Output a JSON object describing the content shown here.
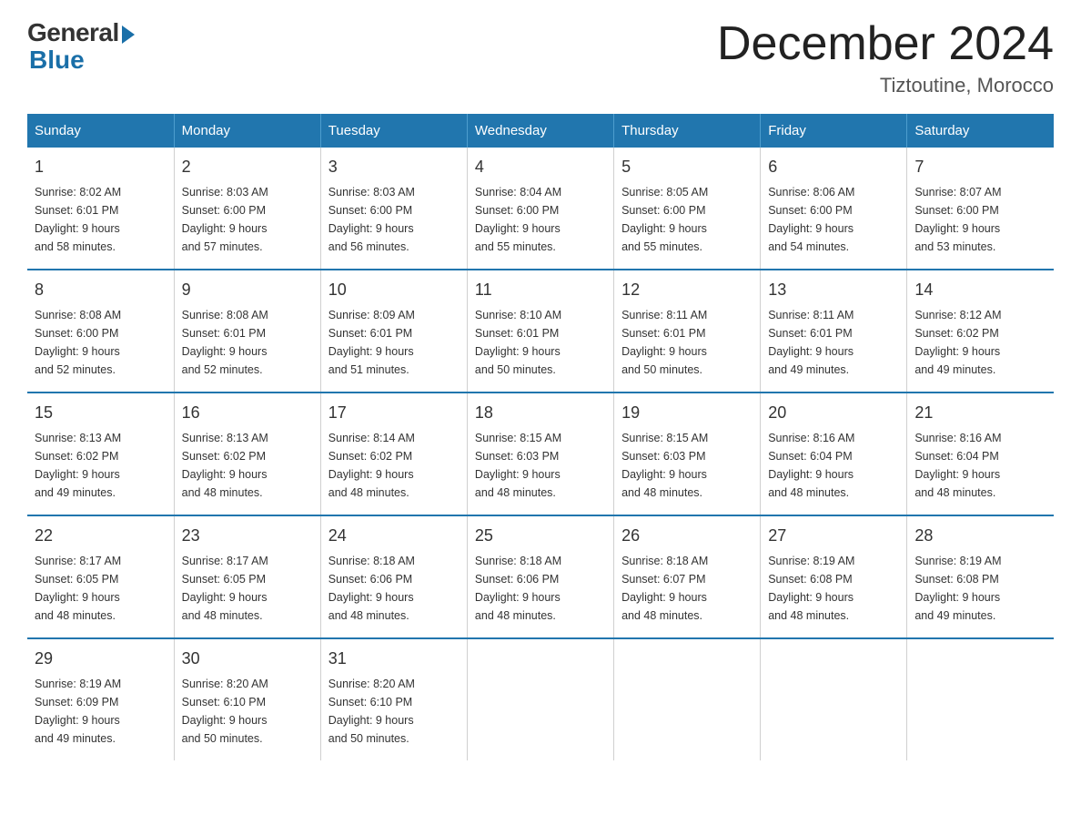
{
  "logo": {
    "general": "General",
    "blue": "Blue"
  },
  "title": "December 2024",
  "location": "Tiztoutine, Morocco",
  "days_header": [
    "Sunday",
    "Monday",
    "Tuesday",
    "Wednesday",
    "Thursday",
    "Friday",
    "Saturday"
  ],
  "weeks": [
    [
      {
        "day": "1",
        "sunrise": "8:02 AM",
        "sunset": "6:01 PM",
        "daylight": "9 hours and 58 minutes."
      },
      {
        "day": "2",
        "sunrise": "8:03 AM",
        "sunset": "6:00 PM",
        "daylight": "9 hours and 57 minutes."
      },
      {
        "day": "3",
        "sunrise": "8:03 AM",
        "sunset": "6:00 PM",
        "daylight": "9 hours and 56 minutes."
      },
      {
        "day": "4",
        "sunrise": "8:04 AM",
        "sunset": "6:00 PM",
        "daylight": "9 hours and 55 minutes."
      },
      {
        "day": "5",
        "sunrise": "8:05 AM",
        "sunset": "6:00 PM",
        "daylight": "9 hours and 55 minutes."
      },
      {
        "day": "6",
        "sunrise": "8:06 AM",
        "sunset": "6:00 PM",
        "daylight": "9 hours and 54 minutes."
      },
      {
        "day": "7",
        "sunrise": "8:07 AM",
        "sunset": "6:00 PM",
        "daylight": "9 hours and 53 minutes."
      }
    ],
    [
      {
        "day": "8",
        "sunrise": "8:08 AM",
        "sunset": "6:00 PM",
        "daylight": "9 hours and 52 minutes."
      },
      {
        "day": "9",
        "sunrise": "8:08 AM",
        "sunset": "6:01 PM",
        "daylight": "9 hours and 52 minutes."
      },
      {
        "day": "10",
        "sunrise": "8:09 AM",
        "sunset": "6:01 PM",
        "daylight": "9 hours and 51 minutes."
      },
      {
        "day": "11",
        "sunrise": "8:10 AM",
        "sunset": "6:01 PM",
        "daylight": "9 hours and 50 minutes."
      },
      {
        "day": "12",
        "sunrise": "8:11 AM",
        "sunset": "6:01 PM",
        "daylight": "9 hours and 50 minutes."
      },
      {
        "day": "13",
        "sunrise": "8:11 AM",
        "sunset": "6:01 PM",
        "daylight": "9 hours and 49 minutes."
      },
      {
        "day": "14",
        "sunrise": "8:12 AM",
        "sunset": "6:02 PM",
        "daylight": "9 hours and 49 minutes."
      }
    ],
    [
      {
        "day": "15",
        "sunrise": "8:13 AM",
        "sunset": "6:02 PM",
        "daylight": "9 hours and 49 minutes."
      },
      {
        "day": "16",
        "sunrise": "8:13 AM",
        "sunset": "6:02 PM",
        "daylight": "9 hours and 48 minutes."
      },
      {
        "day": "17",
        "sunrise": "8:14 AM",
        "sunset": "6:02 PM",
        "daylight": "9 hours and 48 minutes."
      },
      {
        "day": "18",
        "sunrise": "8:15 AM",
        "sunset": "6:03 PM",
        "daylight": "9 hours and 48 minutes."
      },
      {
        "day": "19",
        "sunrise": "8:15 AM",
        "sunset": "6:03 PM",
        "daylight": "9 hours and 48 minutes."
      },
      {
        "day": "20",
        "sunrise": "8:16 AM",
        "sunset": "6:04 PM",
        "daylight": "9 hours and 48 minutes."
      },
      {
        "day": "21",
        "sunrise": "8:16 AM",
        "sunset": "6:04 PM",
        "daylight": "9 hours and 48 minutes."
      }
    ],
    [
      {
        "day": "22",
        "sunrise": "8:17 AM",
        "sunset": "6:05 PM",
        "daylight": "9 hours and 48 minutes."
      },
      {
        "day": "23",
        "sunrise": "8:17 AM",
        "sunset": "6:05 PM",
        "daylight": "9 hours and 48 minutes."
      },
      {
        "day": "24",
        "sunrise": "8:18 AM",
        "sunset": "6:06 PM",
        "daylight": "9 hours and 48 minutes."
      },
      {
        "day": "25",
        "sunrise": "8:18 AM",
        "sunset": "6:06 PM",
        "daylight": "9 hours and 48 minutes."
      },
      {
        "day": "26",
        "sunrise": "8:18 AM",
        "sunset": "6:07 PM",
        "daylight": "9 hours and 48 minutes."
      },
      {
        "day": "27",
        "sunrise": "8:19 AM",
        "sunset": "6:08 PM",
        "daylight": "9 hours and 48 minutes."
      },
      {
        "day": "28",
        "sunrise": "8:19 AM",
        "sunset": "6:08 PM",
        "daylight": "9 hours and 49 minutes."
      }
    ],
    [
      {
        "day": "29",
        "sunrise": "8:19 AM",
        "sunset": "6:09 PM",
        "daylight": "9 hours and 49 minutes."
      },
      {
        "day": "30",
        "sunrise": "8:20 AM",
        "sunset": "6:10 PM",
        "daylight": "9 hours and 50 minutes."
      },
      {
        "day": "31",
        "sunrise": "8:20 AM",
        "sunset": "6:10 PM",
        "daylight": "9 hours and 50 minutes."
      },
      {
        "day": "",
        "sunrise": "",
        "sunset": "",
        "daylight": ""
      },
      {
        "day": "",
        "sunrise": "",
        "sunset": "",
        "daylight": ""
      },
      {
        "day": "",
        "sunrise": "",
        "sunset": "",
        "daylight": ""
      },
      {
        "day": "",
        "sunrise": "",
        "sunset": "",
        "daylight": ""
      }
    ]
  ],
  "labels": {
    "sunrise_prefix": "Sunrise: ",
    "sunset_prefix": "Sunset: ",
    "daylight_prefix": "Daylight: "
  }
}
